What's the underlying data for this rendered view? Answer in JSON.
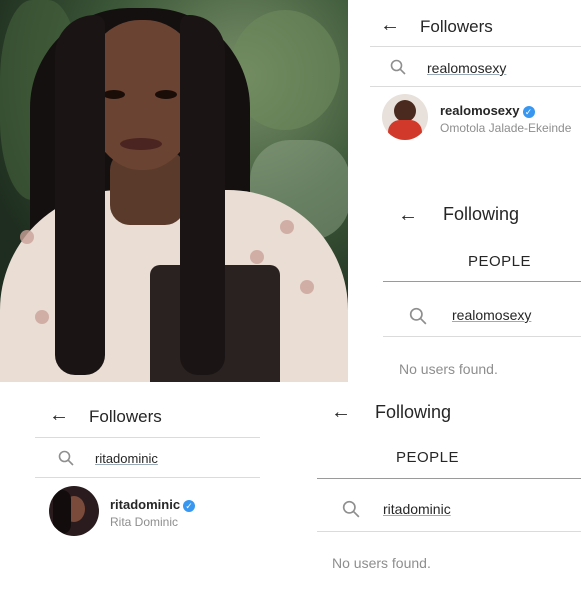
{
  "panel_followers_top": {
    "title": "Followers",
    "search_value": "realomosexy",
    "result": {
      "username": "realomosexy",
      "full_name": "Omotola Jalade-Ekeinde",
      "verified": true
    }
  },
  "panel_following_top": {
    "title": "Following",
    "tab": "PEOPLE",
    "search_value": "realomosexy",
    "empty_text": "No users found."
  },
  "panel_followers_bottom": {
    "title": "Followers",
    "search_value": "ritadominic",
    "result": {
      "username": "ritadominic",
      "full_name": "Rita Dominic",
      "verified": true
    }
  },
  "panel_following_bottom": {
    "title": "Following",
    "tab": "PEOPLE",
    "search_value": "ritadominic",
    "empty_text": "No users found."
  },
  "colors": {
    "verified_blue": "#3897f0",
    "text_primary": "#262626",
    "text_secondary": "#8e8e8e",
    "divider": "#dbdbdb"
  },
  "icons": {
    "back": "back-arrow-icon",
    "search": "search-icon",
    "verified": "verified-badge-icon"
  }
}
